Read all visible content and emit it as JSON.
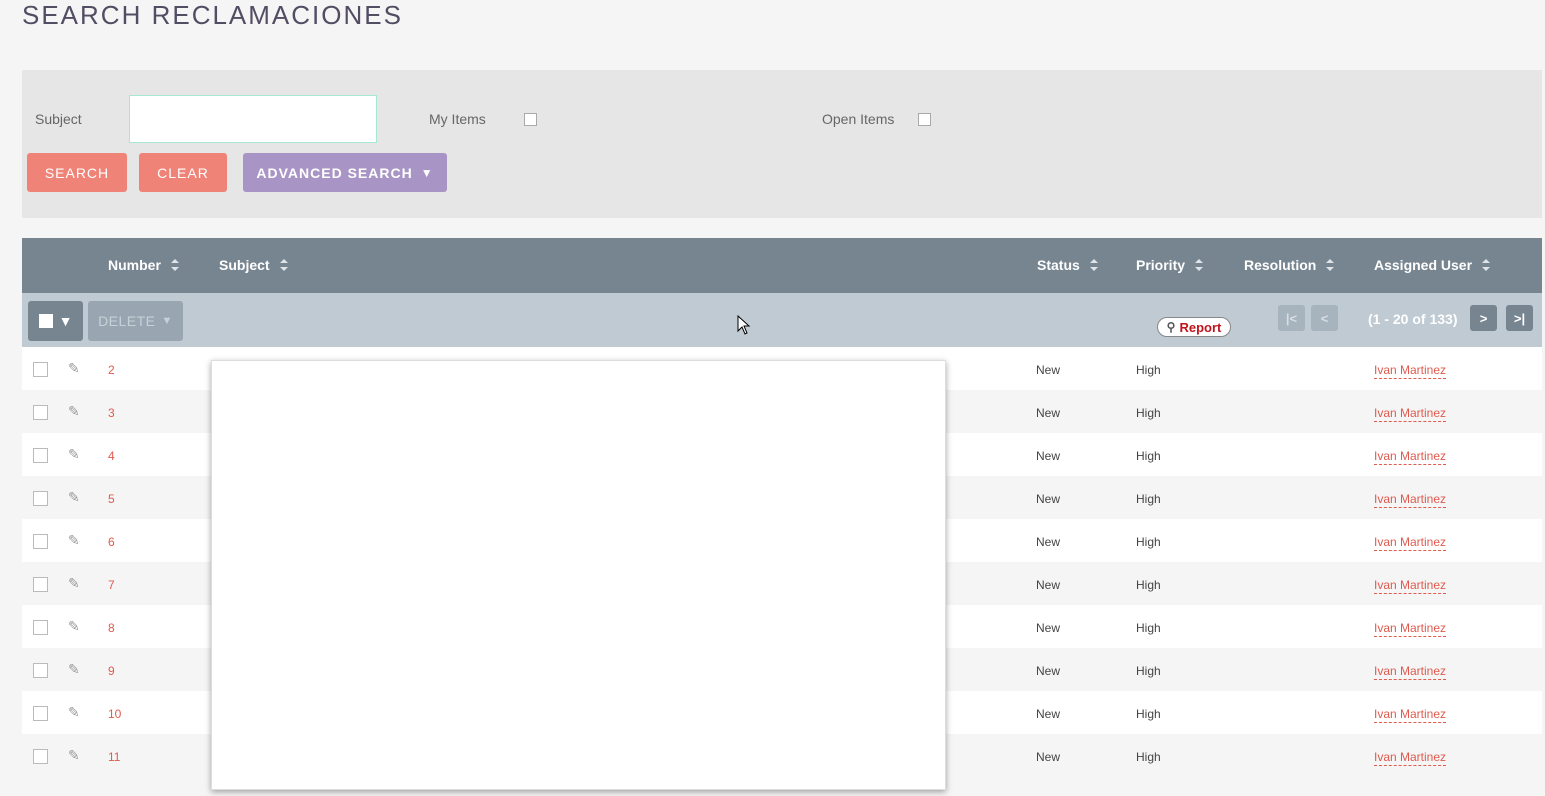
{
  "page": {
    "title": "SEARCH RECLAMACIONES"
  },
  "search": {
    "subject_label": "Subject",
    "subject_value": "",
    "my_items_label": "My Items",
    "open_items_label": "Open Items",
    "search_button": "SEARCH",
    "clear_button": "CLEAR",
    "advanced_button": "ADVANCED SEARCH"
  },
  "table": {
    "columns": {
      "number": "Number",
      "subject": "Subject",
      "status": "Status",
      "priority": "Priority",
      "resolution": "Resolution",
      "assigned_user": "Assigned User"
    },
    "delete_button": "DELETE",
    "report_button": "Report",
    "pagination": {
      "first": "|<",
      "prev": "<",
      "count": "(1 - 20 of 133)",
      "next": ">",
      "last": ">|"
    },
    "rows": [
      {
        "number": "2",
        "status": "New",
        "priority": "High",
        "user": "Ivan Martinez"
      },
      {
        "number": "3",
        "status": "New",
        "priority": "High",
        "user": "Ivan Martinez"
      },
      {
        "number": "4",
        "status": "New",
        "priority": "High",
        "user": "Ivan Martinez"
      },
      {
        "number": "5",
        "status": "New",
        "priority": "High",
        "user": "Ivan Martinez"
      },
      {
        "number": "6",
        "status": "New",
        "priority": "High",
        "user": "Ivan Martinez"
      },
      {
        "number": "7",
        "status": "New",
        "priority": "High",
        "user": "Ivan Martinez"
      },
      {
        "number": "8",
        "status": "New",
        "priority": "High",
        "user": "Ivan Martinez"
      },
      {
        "number": "9",
        "status": "New",
        "priority": "High",
        "user": "Ivan Martinez"
      },
      {
        "number": "10",
        "status": "New",
        "priority": "High",
        "user": "Ivan Martinez"
      },
      {
        "number": "11",
        "status": "New",
        "priority": "High",
        "user": "Ivan Martinez"
      }
    ]
  },
  "colors": {
    "accent_red": "#f08377",
    "accent_purple": "#a895c6",
    "header_bg": "#778591",
    "link_red": "#e05a4e"
  }
}
